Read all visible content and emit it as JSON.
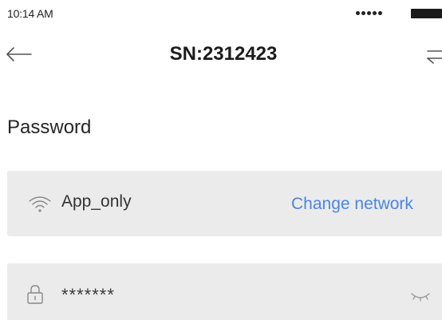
{
  "status_bar": {
    "time": "10:14 AM"
  },
  "nav": {
    "title": "SN:2312423",
    "back_icon": "arrow-left-icon",
    "switch_icon": "swap-arrows-icon"
  },
  "form": {
    "section_title": "Password",
    "network": {
      "icon": "wifi-icon",
      "name": "App_only",
      "change_label": "Change network"
    },
    "password": {
      "icon": "lock-icon",
      "value": "*******",
      "toggle_icon": "eye-closed-icon"
    }
  },
  "colors": {
    "link": "#4a86e0",
    "field_background": "#ebebeb",
    "text": "#1f1f1f"
  }
}
